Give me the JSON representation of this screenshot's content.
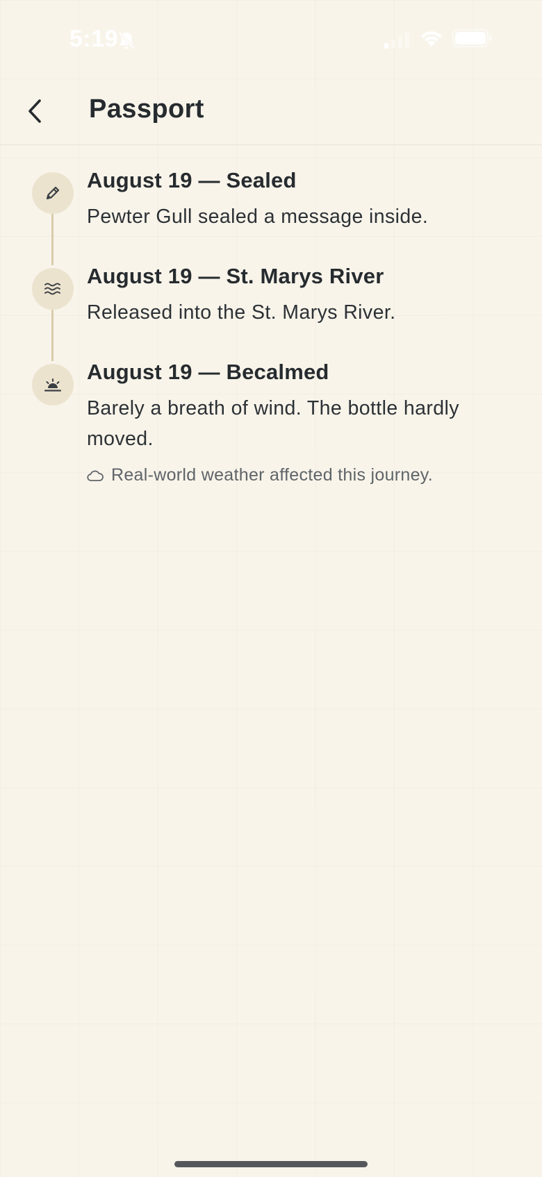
{
  "status_bar": {
    "time": "5:19",
    "icons": [
      "bell-slash-icon",
      "signal-icon",
      "wifi-icon",
      "battery-icon"
    ]
  },
  "header": {
    "back_icon": "chevron-left-icon",
    "title": "Passport"
  },
  "timeline": {
    "events": [
      {
        "icon": "pencil-icon",
        "title": "August 19 — Sealed",
        "body": "Pewter Gull sealed a message inside."
      },
      {
        "icon": "waves-icon",
        "title": "August 19 — St. Marys River",
        "body": "Released into the St. Marys River."
      },
      {
        "icon": "sunrise-icon",
        "title": "August 19 — Becalmed",
        "body": "Barely a breath of wind. The bottle hardly moved.",
        "note_icon": "cloud-icon",
        "note": "Real-world weather affected this journey."
      }
    ]
  },
  "colors": {
    "background": "#f8f4ea",
    "text": "#262b2f",
    "marker": "#ece3cf",
    "connector": "#d9ccaa",
    "note_text": "#5f6468"
  }
}
